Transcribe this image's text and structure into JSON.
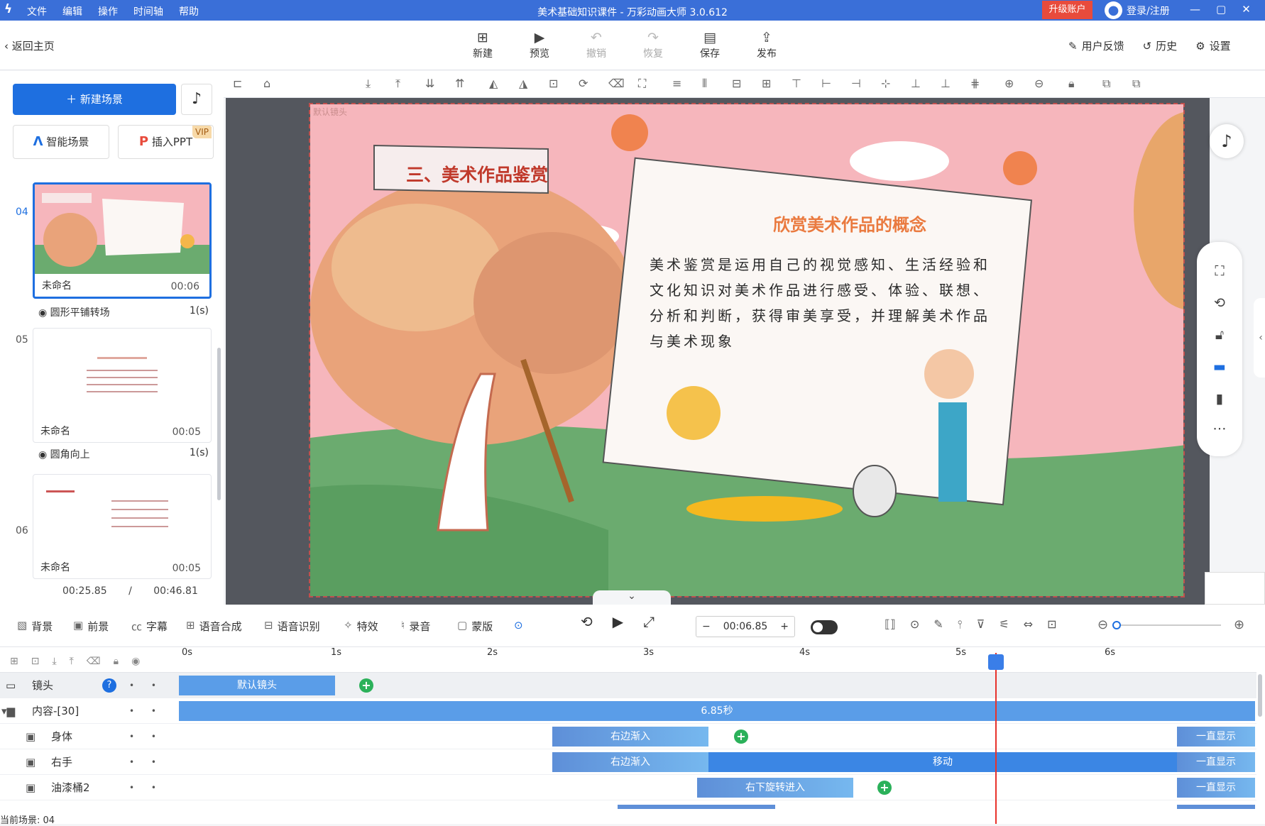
{
  "window": {
    "title": "美术基础知识课件 - 万彩动画大师 3.0.612",
    "menu": [
      "文件",
      "编辑",
      "操作",
      "时间轴",
      "帮助"
    ],
    "upgrade": "升级账户",
    "login": "登录/注册"
  },
  "toolbar": {
    "back": "返回主页",
    "buttons": [
      {
        "label": "新建",
        "icon": "plus-box-icon",
        "enabled": true
      },
      {
        "label": "预览",
        "icon": "play-icon",
        "enabled": true
      },
      {
        "label": "撤销",
        "icon": "undo-icon",
        "enabled": false
      },
      {
        "label": "恢复",
        "icon": "redo-icon",
        "enabled": false
      },
      {
        "label": "保存",
        "icon": "save-icon",
        "enabled": true
      },
      {
        "label": "发布",
        "icon": "publish-icon",
        "enabled": true
      }
    ],
    "right": [
      "用户反馈",
      "历史",
      "设置"
    ]
  },
  "left_panel": {
    "new_scene": "新建场景",
    "smart_scene": "智能场景",
    "insert_ppt": "插入PPT",
    "vip": "VIP",
    "scenes": [
      {
        "num": "04",
        "name": "未命名",
        "time": "00:06",
        "selected": true,
        "transition": "圆形平铺转场",
        "trans_dur": "1(s)"
      },
      {
        "num": "05",
        "name": "未命名",
        "time": "00:05",
        "selected": false,
        "transition": "圆角向上",
        "trans_dur": "1(s)"
      },
      {
        "num": "06",
        "name": "未命名",
        "time": "00:05",
        "selected": false
      }
    ],
    "current_time": "00:25.85",
    "total_time": "/ 00:46.81"
  },
  "canvas": {
    "camera_label": "默认镜头",
    "slide_title": "三、美术作品鉴赏",
    "paper_title": "欣赏美术作品的概念",
    "paper_body": "美术鉴赏是运用自己的视觉感知、生活经验和文化知识对美术作品进行感受、体验、联想、分析和判断，获得审美享受，并理解美术作品与美术现象",
    "colors": {
      "sky": "#f6b6bc",
      "ground": "#6bab6f",
      "tree": "#e9a37a",
      "paper": "#fbf7f4"
    }
  },
  "bottom_toolbar": {
    "tools": [
      "背景",
      "前景",
      "字幕",
      "语音合成",
      "语音识别",
      "特效",
      "录音",
      "蒙版"
    ],
    "timecode": "00:06.85"
  },
  "timeline": {
    "ticks": [
      "0s",
      "1s",
      "2s",
      "3s",
      "4s",
      "5s",
      "6s"
    ],
    "tracks": [
      {
        "label": "镜头",
        "bars": [
          {
            "text": "默认镜头"
          }
        ]
      },
      {
        "label": "内容-[30]",
        "bars": [
          {
            "text": "6.85秒"
          }
        ]
      },
      {
        "label": "身体",
        "bars": [
          {
            "text": "右边渐入"
          },
          {
            "text": "一直显示"
          }
        ]
      },
      {
        "label": "右手",
        "bars": [
          {
            "text": "右边渐入"
          },
          {
            "text": "移动"
          },
          {
            "text": "一直显示"
          }
        ]
      },
      {
        "label": "油漆桶2",
        "bars": [
          {
            "text": "右下旋转进入"
          },
          {
            "text": "一直显示"
          }
        ]
      }
    ],
    "status": "当前场景: 04"
  }
}
